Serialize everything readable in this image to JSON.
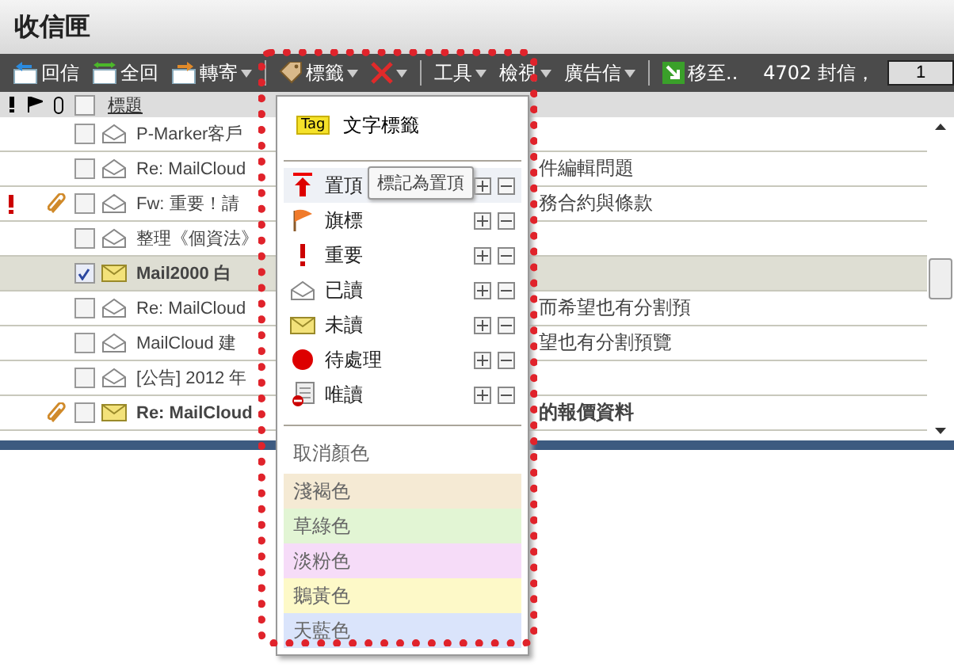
{
  "window": {
    "title": "收信匣"
  },
  "toolbar": [
    {
      "kind": "reply",
      "label": "回信",
      "dropdown": false
    },
    {
      "kind": "reply-all",
      "label": "全回",
      "dropdown": false
    },
    {
      "kind": "forward",
      "label": "轉寄",
      "dropdown": true
    },
    {
      "kind": "separator"
    },
    {
      "kind": "tag",
      "label": "標籤",
      "dropdown": true
    },
    {
      "kind": "delete",
      "dropdown": true
    },
    {
      "kind": "separator"
    },
    {
      "kind": "text",
      "label": "工具",
      "dropdown": true
    },
    {
      "kind": "text",
      "label": "檢視",
      "dropdown": true
    },
    {
      "kind": "text",
      "label": "廣告信",
      "dropdown": true
    },
    {
      "kind": "separator"
    },
    {
      "kind": "move",
      "label": "移至..",
      "dropdown": false
    }
  ],
  "message_count": "4702 封信，",
  "page_field": {
    "value": "1"
  },
  "header": {
    "subject": "標題",
    "all_checked": false
  },
  "rows": [
    {
      "important": false,
      "attachment": false,
      "checked": false,
      "selected": false,
      "unread": false,
      "subject": "P-Marker客戶",
      "tail": ""
    },
    {
      "important": false,
      "attachment": false,
      "checked": false,
      "selected": false,
      "unread": false,
      "subject": "Re: MailCloud",
      "tail": "件編輯問題"
    },
    {
      "important": true,
      "attachment": true,
      "checked": false,
      "selected": false,
      "unread": false,
      "subject": "Fw: 重要！請",
      "tail": "務合約與條款"
    },
    {
      "important": false,
      "attachment": false,
      "checked": false,
      "selected": false,
      "unread": false,
      "subject": "整理《個資法》",
      "tail": ""
    },
    {
      "important": false,
      "attachment": false,
      "checked": true,
      "selected": true,
      "unread": true,
      "subject": "Mail2000 白",
      "tail": ""
    },
    {
      "important": false,
      "attachment": false,
      "checked": false,
      "selected": false,
      "unread": false,
      "subject": "Re: MailCloud",
      "tail": "而希望也有分割預"
    },
    {
      "important": false,
      "attachment": false,
      "checked": false,
      "selected": false,
      "unread": false,
      "subject": "MailCloud 建",
      "tail": "望也有分割預覽"
    },
    {
      "important": false,
      "attachment": false,
      "checked": false,
      "selected": false,
      "unread": false,
      "subject": "[公告] 2012 年",
      "tail": ""
    },
    {
      "important": false,
      "attachment": true,
      "checked": false,
      "selected": false,
      "unread": true,
      "subject": "Re: MailCloud",
      "tail": "的報價資料"
    }
  ],
  "menu": {
    "tag_item": {
      "badge": "Tag",
      "label": "文字標籤"
    },
    "marks": [
      {
        "kind": "pin",
        "label": "置頂",
        "selected": true
      },
      {
        "kind": "flag",
        "label": "旗標",
        "selected": false
      },
      {
        "kind": "important",
        "label": "重要",
        "selected": false
      },
      {
        "kind": "read",
        "label": "已讀",
        "selected": false
      },
      {
        "kind": "unread",
        "label": "未讀",
        "selected": false
      },
      {
        "kind": "pending",
        "label": "待處理",
        "selected": false
      },
      {
        "kind": "readonly",
        "label": "唯讀",
        "selected": false
      }
    ],
    "clear_color": "取消顏色",
    "colors": [
      {
        "label": "淺褐色",
        "color": "#f5ead4"
      },
      {
        "label": "草綠色",
        "color": "#e2f5d4"
      },
      {
        "label": "淡粉色",
        "color": "#f6dcf8"
      },
      {
        "label": "鵝黃色",
        "color": "#fdf9c8"
      },
      {
        "label": "天藍色",
        "color": "#dae4fb"
      }
    ]
  },
  "tooltip": "標記為置頂"
}
